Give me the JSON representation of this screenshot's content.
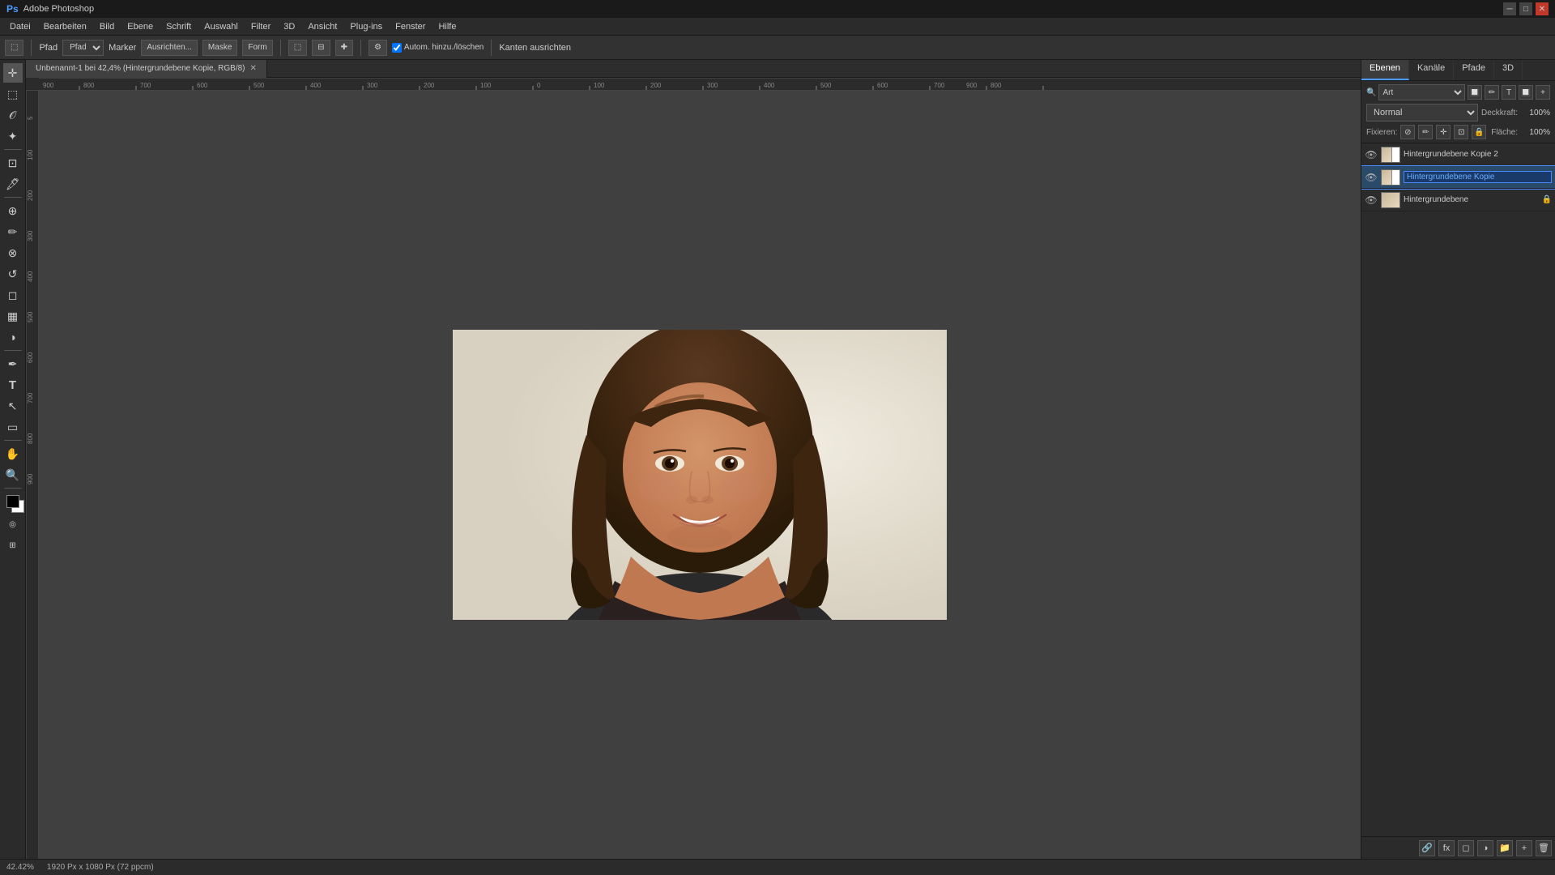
{
  "titlebar": {
    "title": "Adobe Photoshop",
    "minimize": "─",
    "maximize": "□",
    "close": "✕"
  },
  "menubar": {
    "items": [
      "Datei",
      "Bearbeiten",
      "Bild",
      "Ebene",
      "Schrift",
      "Auswahl",
      "Filter",
      "3D",
      "Ansicht",
      "Plug-ins",
      "Fenster",
      "Hilfe"
    ]
  },
  "optionsbar": {
    "path_label": "Pfad",
    "marker_label": "Marker",
    "ausrichten_label": "Ausrichten...",
    "maske_label": "Maske",
    "form_label": "Form",
    "autom_label": "Autom. hinzu./löschen",
    "kanten_label": "Kanten ausrichten"
  },
  "document": {
    "tab_title": "Unbenannt-1 bei 42,4% (Hintergrundebene Kopie, RGB/8)",
    "zoom": "42.42%",
    "dimensions": "1920 Px x 1080 Px (72 ppcm)"
  },
  "layers_panel": {
    "tabs": [
      "Ebenen",
      "Kanäle",
      "Pfade",
      "3D"
    ],
    "active_tab": "Ebenen",
    "blend_mode_label": "Art",
    "blend_mode_value": "Normal",
    "opacity_label": "Deckkraft:",
    "opacity_value": "100%",
    "lock_label": "Fixieren:",
    "fill_label": "Fläche:",
    "fill_value": "100%",
    "layers": [
      {
        "id": "layer-3",
        "name": "Hintergrundebene Kopie 2",
        "visible": true,
        "active": false,
        "editing": false
      },
      {
        "id": "layer-2",
        "name": "Hintergrundebene Kopie",
        "visible": true,
        "active": true,
        "editing": true
      },
      {
        "id": "layer-1",
        "name": "Hintergrundebene",
        "visible": true,
        "active": false,
        "editing": false
      }
    ]
  },
  "toolbar": {
    "tools": [
      {
        "name": "move",
        "icon": "✛",
        "label": "Verschieben"
      },
      {
        "name": "select-rect",
        "icon": "⬚",
        "label": "Rechteckauswahl"
      },
      {
        "name": "lasso",
        "icon": "𝒪",
        "label": "Lasso"
      },
      {
        "name": "magic-wand",
        "icon": "✦",
        "label": "Zauberstab"
      },
      {
        "name": "crop",
        "icon": "⊡",
        "label": "Freistellen"
      },
      {
        "name": "eyedropper",
        "icon": "🖋",
        "label": "Pipette"
      },
      {
        "name": "healing",
        "icon": "⊕",
        "label": "Reparaturpinsel"
      },
      {
        "name": "brush",
        "icon": "✏",
        "label": "Pinsel"
      },
      {
        "name": "clone",
        "icon": "⊗",
        "label": "Kopierstempel"
      },
      {
        "name": "history-brush",
        "icon": "↺",
        "label": "Protokollpinsel"
      },
      {
        "name": "eraser",
        "icon": "◻",
        "label": "Radierer"
      },
      {
        "name": "gradient",
        "icon": "▦",
        "label": "Verlauf"
      },
      {
        "name": "dodge",
        "icon": "◑",
        "label": "Abwedler"
      },
      {
        "name": "pen",
        "icon": "✒",
        "label": "Zeichenstift"
      },
      {
        "name": "text",
        "icon": "T",
        "label": "Text"
      },
      {
        "name": "path-select",
        "icon": "↖",
        "label": "Pfadauswahl"
      },
      {
        "name": "shape",
        "icon": "▭",
        "label": "Form"
      },
      {
        "name": "hand",
        "icon": "✋",
        "label": "Hand"
      },
      {
        "name": "zoom",
        "icon": "⊕",
        "label": "Zoom"
      }
    ]
  },
  "colors": {
    "foreground": "#000000",
    "background": "#ffffff",
    "accent_blue": "#4a8aff",
    "layer_active_bg": "#3c5a8a",
    "layer_editing_highlight": "#6aadff"
  },
  "statusbar": {
    "zoom_value": "42.42%",
    "doc_size": "1920 Px x 1080 Px (72 ppcm)"
  }
}
